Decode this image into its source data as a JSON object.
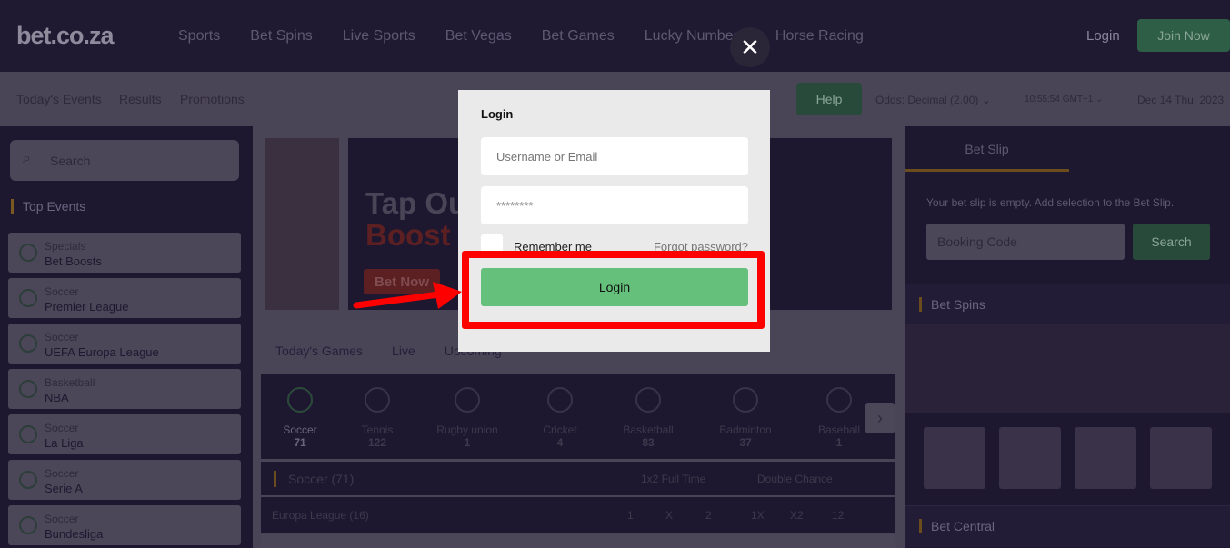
{
  "header": {
    "logo": "bet.co.za",
    "nav": [
      "Sports",
      "Bet Spins",
      "Live Sports",
      "Bet Vegas",
      "Bet Games",
      "Lucky Numbers",
      "Horse Racing"
    ],
    "login": "Login",
    "join": "Join Now"
  },
  "subnav": {
    "links": [
      "Today's Events",
      "Results",
      "Promotions"
    ],
    "help": "Help",
    "odds": "Odds: Decimal (2.00) ⌄",
    "time": "10:55:54  GMT+1 ⌄",
    "date": "Dec 14 Thu, 2023"
  },
  "sidebar": {
    "search_placeholder": "Search",
    "top_events": "Top Events",
    "items": [
      {
        "cat": "Specials",
        "name": "Bet Boosts"
      },
      {
        "cat": "Soccer",
        "name": "Premier League"
      },
      {
        "cat": "Soccer",
        "name": "UEFA Europa League"
      },
      {
        "cat": "Basketball",
        "name": "NBA"
      },
      {
        "cat": "Soccer",
        "name": "La Liga"
      },
      {
        "cat": "Soccer",
        "name": "Serie A"
      },
      {
        "cat": "Soccer",
        "name": "Bundesliga"
      }
    ]
  },
  "banner": {
    "line1": "Tap Ou",
    "line2": "Boost",
    "cta": "Bet Now"
  },
  "main": {
    "tabs": [
      "Today's Games",
      "Live",
      "Upcoming"
    ],
    "sports": [
      {
        "name": "Soccer",
        "count": "71"
      },
      {
        "name": "Tennis",
        "count": "122"
      },
      {
        "name": "Rugby union",
        "count": "1"
      },
      {
        "name": "Cricket",
        "count": "4"
      },
      {
        "name": "Basketball",
        "count": "83"
      },
      {
        "name": "Badminton",
        "count": "37"
      },
      {
        "name": "Baseball",
        "count": "1"
      }
    ],
    "section": "Soccer  (71)",
    "market1": "1x2 Full Time",
    "market2": "Double Chance",
    "league": "Europa League (16)",
    "cols": [
      "1",
      "X",
      "2",
      "1X",
      "X2",
      "12"
    ]
  },
  "betslip": {
    "tab": "Bet Slip",
    "empty": "Your bet slip is empty. Add selection to the Bet Slip.",
    "booking_placeholder": "Booking Code",
    "search": "Search",
    "bet_spins": "Bet Spins",
    "bet_central": "Bet Central"
  },
  "modal": {
    "title": "Login",
    "username_placeholder": "Username or Email",
    "password_value": "********",
    "remember": "Remember me",
    "forgot": "Forgot password?",
    "login_button": "Login",
    "close": "✕"
  },
  "colors": {
    "accent_green": "#64c07a",
    "highlight": "#ff0000"
  }
}
